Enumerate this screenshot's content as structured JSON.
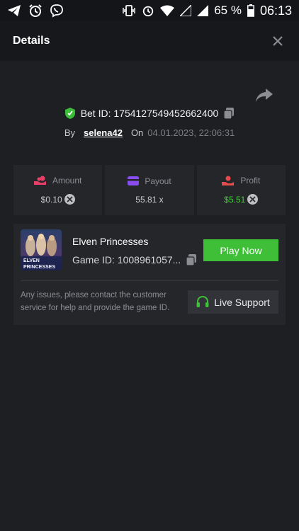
{
  "status_bar": {
    "battery": "65 %",
    "time": "06:13",
    "left_icons": [
      "telegram-icon",
      "alarm-icon",
      "viber-icon"
    ],
    "right_icons": [
      "vibrate-icon",
      "alarm-icon",
      "wifi-icon",
      "signal-icon",
      "signal-icon",
      "battery-icon"
    ]
  },
  "header": {
    "title": "Details"
  },
  "bet": {
    "id_text": "Bet ID: 1754127549452662400",
    "by_label": "By",
    "user": "selena42",
    "on_label": "On",
    "date": "04.01.2023, 22:06:31"
  },
  "stats": [
    {
      "label": "Amount",
      "value": "$0.10",
      "icon": "coins-hand-icon",
      "has_x": true
    },
    {
      "label": "Payout",
      "value": "55.81 x",
      "icon": "card-icon",
      "has_x": false
    },
    {
      "label": "Profit",
      "value": "$5.51",
      "icon": "money-hand-icon",
      "has_x": true
    }
  ],
  "game": {
    "name": "Elven Princesses",
    "id_text": "Game ID: 1008961057...",
    "thumb_text_1": "ELVEN",
    "thumb_text_2": "PRINCESSES",
    "play_label": "Play Now",
    "issue_text": "Any issues, please contact the customer service for help and provide the game ID.",
    "support_label": "Live Support"
  },
  "colors": {
    "accent_green": "#3fbe37",
    "profit_green": "#46c940",
    "amount_icon": "#e9406a",
    "payout_icon": "#8a4df2",
    "profit_icon": "#e54b4b",
    "verified_green": "#3bbd3b"
  }
}
